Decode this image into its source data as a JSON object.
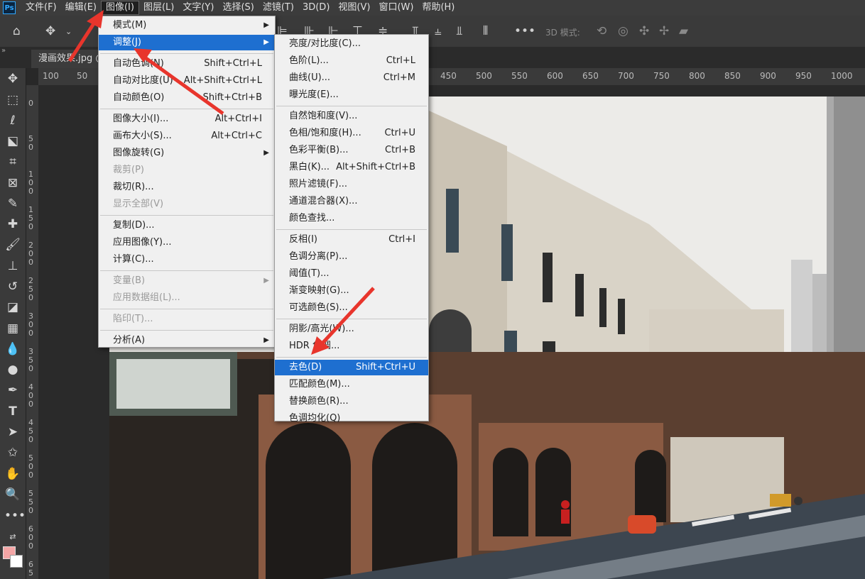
{
  "app": {
    "logo": "Ps"
  },
  "menubar": [
    {
      "label": "文件(F)"
    },
    {
      "label": "编辑(E)"
    },
    {
      "label": "图像(I)",
      "active": true
    },
    {
      "label": "图层(L)"
    },
    {
      "label": "文字(Y)"
    },
    {
      "label": "选择(S)"
    },
    {
      "label": "滤镜(T)"
    },
    {
      "label": "3D(D)"
    },
    {
      "label": "视图(V)"
    },
    {
      "label": "窗口(W)"
    },
    {
      "label": "帮助(H)"
    }
  ],
  "optionsbar": {
    "mode3d": "3D 模式:"
  },
  "document": {
    "tab_label": "漫画效果.jpg @"
  },
  "ruler": {
    "top": [
      "100",
      "50",
      "450",
      "500",
      "550",
      "600",
      "650",
      "700",
      "750",
      "800",
      "850",
      "900",
      "950",
      "1000"
    ],
    "left": [
      "0",
      "5\n0",
      "1\n0\n0",
      "1\n5\n0",
      "2\n0\n0",
      "2\n5\n0",
      "3\n0\n0",
      "3\n5\n0",
      "4\n0\n0",
      "4\n5\n0",
      "5\n0\n0",
      "5\n5\n0",
      "6\n0\n0",
      "6\n5"
    ]
  },
  "image_menu": {
    "items": [
      {
        "label": "模式(M)",
        "submenu": true
      },
      {
        "label": "调整(J)",
        "submenu": true,
        "highlighted": true
      },
      {
        "sep": true
      },
      {
        "label": "自动色调(N)",
        "shortcut": "Shift+Ctrl+L"
      },
      {
        "label": "自动对比度(U)",
        "shortcut": "Alt+Shift+Ctrl+L"
      },
      {
        "label": "自动颜色(O)",
        "shortcut": "Shift+Ctrl+B"
      },
      {
        "sep": true
      },
      {
        "label": "图像大小(I)...",
        "shortcut": "Alt+Ctrl+I"
      },
      {
        "label": "画布大小(S)...",
        "shortcut": "Alt+Ctrl+C"
      },
      {
        "label": "图像旋转(G)",
        "submenu": true
      },
      {
        "label": "裁剪(P)",
        "disabled": true
      },
      {
        "label": "裁切(R)..."
      },
      {
        "label": "显示全部(V)",
        "disabled": true
      },
      {
        "sep": true
      },
      {
        "label": "复制(D)..."
      },
      {
        "label": "应用图像(Y)..."
      },
      {
        "label": "计算(C)..."
      },
      {
        "sep": true
      },
      {
        "label": "变量(B)",
        "submenu": true,
        "disabled": true
      },
      {
        "label": "应用数据组(L)...",
        "disabled": true
      },
      {
        "sep": true
      },
      {
        "label": "陷印(T)...",
        "disabled": true
      },
      {
        "sep": true
      },
      {
        "label": "分析(A)",
        "submenu": true
      }
    ]
  },
  "adjust_menu": {
    "items": [
      {
        "label": "亮度/对比度(C)..."
      },
      {
        "label": "色阶(L)...",
        "shortcut": "Ctrl+L"
      },
      {
        "label": "曲线(U)...",
        "shortcut": "Ctrl+M"
      },
      {
        "label": "曝光度(E)..."
      },
      {
        "sep": true
      },
      {
        "label": "自然饱和度(V)..."
      },
      {
        "label": "色相/饱和度(H)...",
        "shortcut": "Ctrl+U"
      },
      {
        "label": "色彩平衡(B)...",
        "shortcut": "Ctrl+B"
      },
      {
        "label": "黑白(K)...",
        "shortcut": "Alt+Shift+Ctrl+B"
      },
      {
        "label": "照片滤镜(F)..."
      },
      {
        "label": "通道混合器(X)..."
      },
      {
        "label": "颜色查找..."
      },
      {
        "sep": true
      },
      {
        "label": "反相(I)",
        "shortcut": "Ctrl+I"
      },
      {
        "label": "色调分离(P)..."
      },
      {
        "label": "阈值(T)..."
      },
      {
        "label": "渐变映射(G)..."
      },
      {
        "label": "可选颜色(S)..."
      },
      {
        "sep": true
      },
      {
        "label": "阴影/高光(W)..."
      },
      {
        "label": "HDR 色调..."
      },
      {
        "sep": true
      },
      {
        "label": "去色(D)",
        "shortcut": "Shift+Ctrl+U",
        "highlighted": true
      },
      {
        "label": "匹配颜色(M)..."
      },
      {
        "label": "替换颜色(R)..."
      },
      {
        "label": "色调均化(Q)"
      }
    ]
  },
  "colors": {
    "highlight": "#1e6fd0",
    "annotation": "#e8352c",
    "ps_blue": "#31a8ff"
  }
}
